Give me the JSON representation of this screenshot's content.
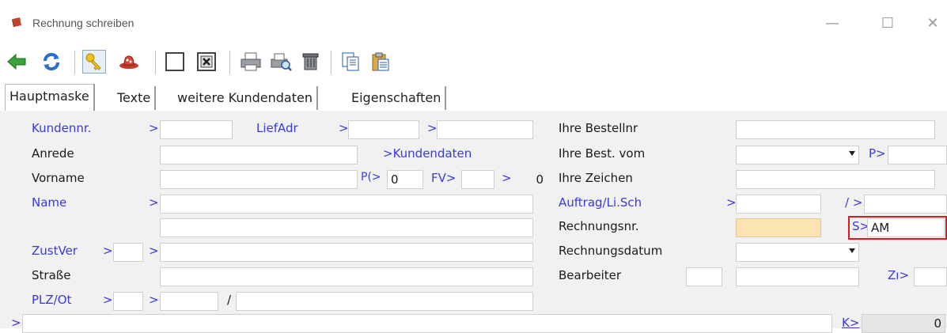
{
  "window": {
    "title": "Rechnung schreiben",
    "controls": {
      "minimize": "—",
      "maximize": "☐",
      "close": "✕"
    }
  },
  "toolbar": {
    "icons": [
      "back-arrow-icon",
      "refresh-icon",
      "key-icon",
      "hat-icon",
      "blank-document-icon",
      "close-document-icon",
      "print-icon",
      "print-preview-icon",
      "trash-icon",
      "copy-icon",
      "paste-icon"
    ]
  },
  "tabs": [
    "Hauptmaske",
    "Texte",
    "weitere Kundendaten",
    "Eigenschaften"
  ],
  "form": {
    "kundennr": {
      "label": "Kundennr.",
      "arrow": ">",
      "value": ""
    },
    "liefadr": {
      "label": "LiefAdr",
      "arrow1": ">",
      "value1": "",
      "arrow2": ">",
      "value2": ""
    },
    "anrede": {
      "label": "Anrede",
      "value": ""
    },
    "kundendaten_link": ">Kundendaten",
    "vorname": {
      "label": "Vorname",
      "value": ""
    },
    "p_field": {
      "label": "P(>",
      "value": "0"
    },
    "fv_field": {
      "label": "FV>",
      "value": "",
      "arrow": ">",
      "value2": "0"
    },
    "name": {
      "label": "Name",
      "arrow": ">",
      "value": "",
      "value2": ""
    },
    "zustver": {
      "label": "ZustVer",
      "arrow1": ">",
      "value1": "",
      "arrow2": ">",
      "value2": ""
    },
    "strasse": {
      "label": "Straße",
      "value": ""
    },
    "plz_ort": {
      "label": "PLZ/Ot",
      "arrow1": ">",
      "value1": "",
      "arrow2": ">",
      "value2": "",
      "slash": "/",
      "value3": ""
    },
    "bottom_arrow": ">",
    "bottom_value": "",
    "ihre_bestellnr": {
      "label": "Ihre Bestellnr",
      "value": ""
    },
    "ihre_best_vom": {
      "label": "Ihre Best. vom",
      "value": "",
      "p_label": "P>",
      "p_value": ""
    },
    "ihre_zeichen": {
      "label": "Ihre Zeichen",
      "value": ""
    },
    "auftrag": {
      "label": "Auftrag/Li.Sch",
      "arrow": ">",
      "value": "",
      "slash": "/ >",
      "value2": ""
    },
    "rechnungsnr": {
      "label": "Rechnungsnr.",
      "value": "",
      "s_label": "S>",
      "s_value": "AM"
    },
    "rechnungsdatum": {
      "label": "Rechnungsdatum",
      "value": ""
    },
    "bearbeiter": {
      "label": "Bearbeiter",
      "value1": "",
      "value2": "",
      "zu_label": "Zı>",
      "zu_value": ""
    },
    "k_field": {
      "label": "K>",
      "value": "0"
    }
  },
  "colors": {
    "link_blue": "#3a3ad8",
    "highlight_red": "#e0191f",
    "field_yellow": "#fbe4b2"
  }
}
